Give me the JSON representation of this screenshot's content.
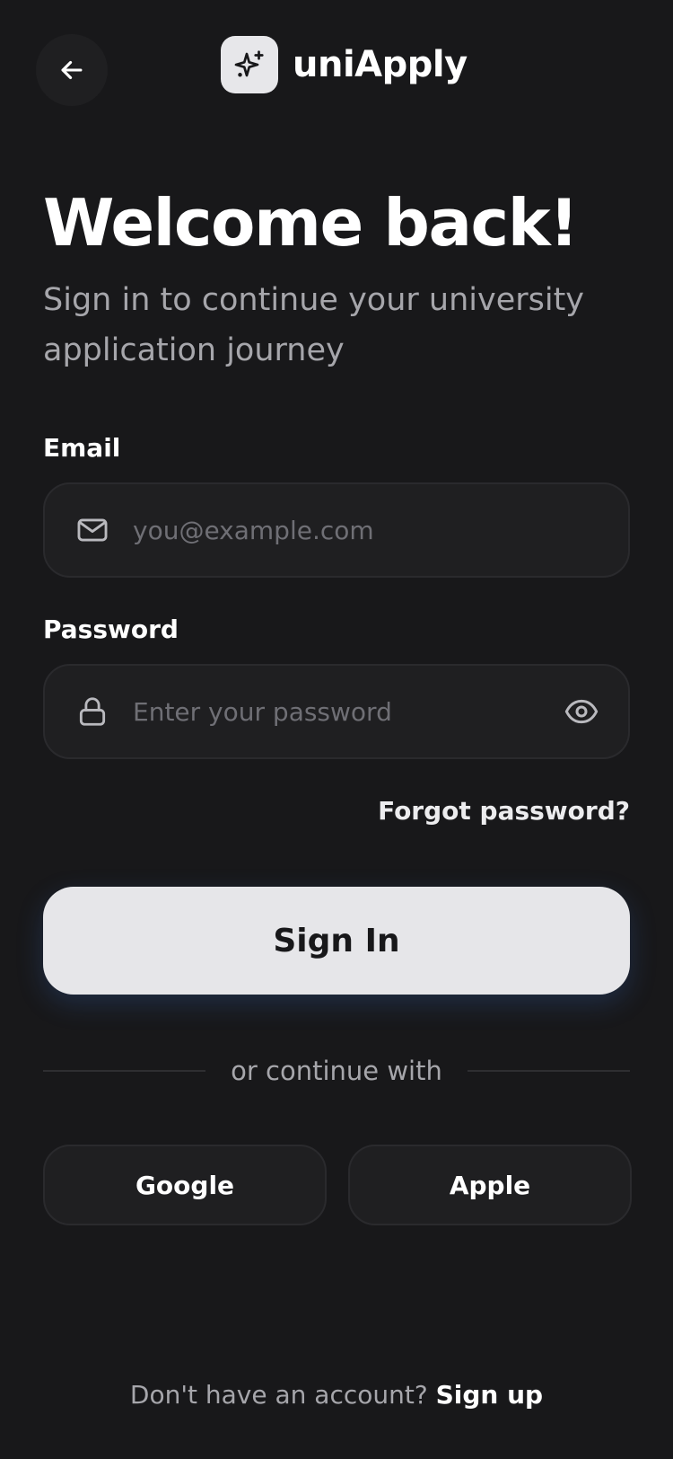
{
  "header": {
    "back_icon": "arrow-left-icon",
    "brand_icon": "sparkle-icon",
    "brand_name": "uniApply"
  },
  "intro": {
    "title": "Welcome back!",
    "subtitle": "Sign in to continue your university application journey"
  },
  "form": {
    "email": {
      "label": "Email",
      "placeholder": "you@example.com",
      "value": "",
      "icon": "mail-icon"
    },
    "password": {
      "label": "Password",
      "placeholder": "Enter your password",
      "value": "",
      "icon": "lock-icon",
      "toggle_icon": "eye-icon"
    },
    "forgot_label": "Forgot password?",
    "submit_label": "Sign In"
  },
  "divider": {
    "label": "or continue with"
  },
  "social": {
    "google_label": "Google",
    "apple_label": "Apple"
  },
  "footer": {
    "prompt": "Don't have an account? ",
    "signup_label": "Sign up"
  },
  "colors": {
    "background": "#18181a",
    "surface": "#1f1f21",
    "border": "#2a2a2d",
    "primary_button": "#e6e6e9",
    "text_primary": "#ffffff",
    "text_secondary": "#a6a6ab",
    "placeholder": "#6f6f75"
  }
}
